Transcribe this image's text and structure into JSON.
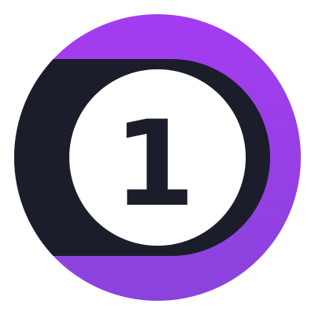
{
  "logo": {
    "number": "1",
    "colors": {
      "purple_top": "#A43CF1",
      "purple_bottom": "#8A43DC",
      "dark": "#1C1D2B",
      "inner": "#FFFFFF",
      "background": "#FFFFFF"
    },
    "icon_name": "numbered-badge-icon"
  }
}
